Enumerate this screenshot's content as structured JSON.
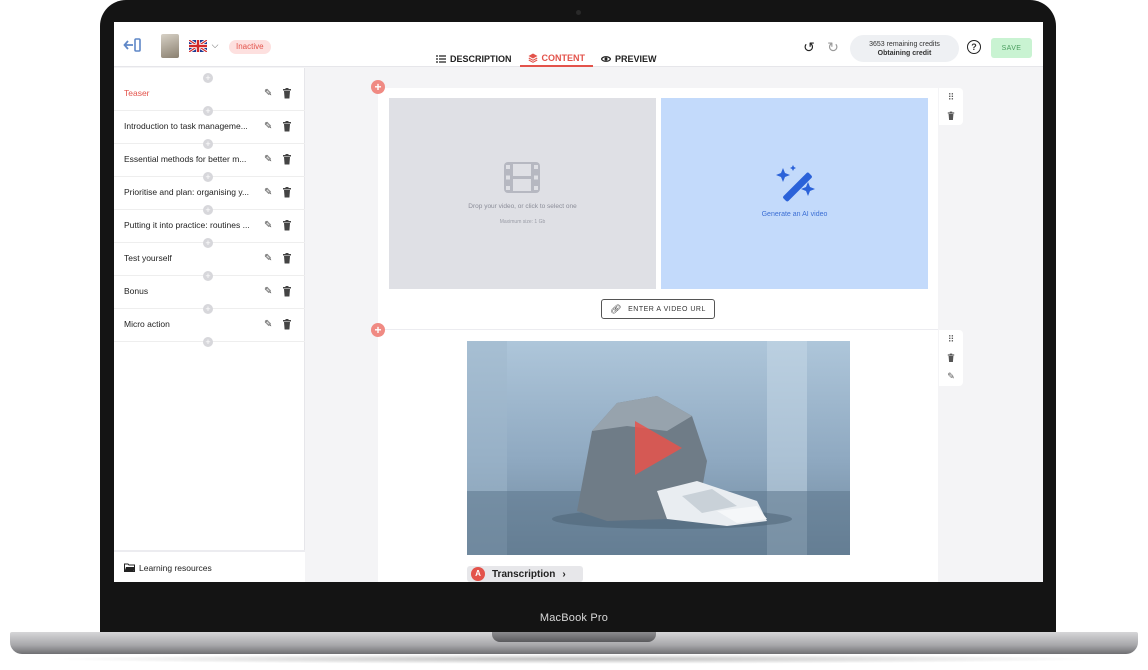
{
  "device": {
    "model_label": "MacBook Pro"
  },
  "topbar": {
    "status_badge": "Inactive",
    "tabs": [
      {
        "label": "DESCRIPTION",
        "icon": "list-icon",
        "active": false
      },
      {
        "label": "CONTENT",
        "icon": "layers-icon",
        "active": true
      },
      {
        "label": "PREVIEW",
        "icon": "eye-icon",
        "active": false
      }
    ],
    "credits_line1": "3653 remaining credits",
    "credits_line2": "Obtaining credit",
    "help_label": "?",
    "save_label": "SAVE"
  },
  "sidebar": {
    "sections": [
      {
        "title": "Teaser",
        "active": true
      },
      {
        "title": "Introduction to task manageme...",
        "active": false
      },
      {
        "title": "Essential methods for better m...",
        "active": false
      },
      {
        "title": "Prioritise and plan: organising y...",
        "active": false
      },
      {
        "title": "Putting it into practice: routines ...",
        "active": false
      },
      {
        "title": "Test yourself",
        "active": false
      },
      {
        "title": "Bonus",
        "active": false
      },
      {
        "title": "Micro action",
        "active": false
      }
    ],
    "resources_label": "Learning resources"
  },
  "content": {
    "drop_text": "Drop your video, or click to select one",
    "drop_subtext": "Maximum size: 1 Gb",
    "ai_text": "Generate an AI video",
    "url_button": "ENTER A VIDEO URL",
    "transcription_avatar": "A",
    "transcription_label": "Transcription"
  },
  "colors": {
    "accent": "#e3534b",
    "ai_panel": "#c3dafb",
    "ai_text": "#3c6fd4",
    "save_bg": "#c9f3d2"
  }
}
